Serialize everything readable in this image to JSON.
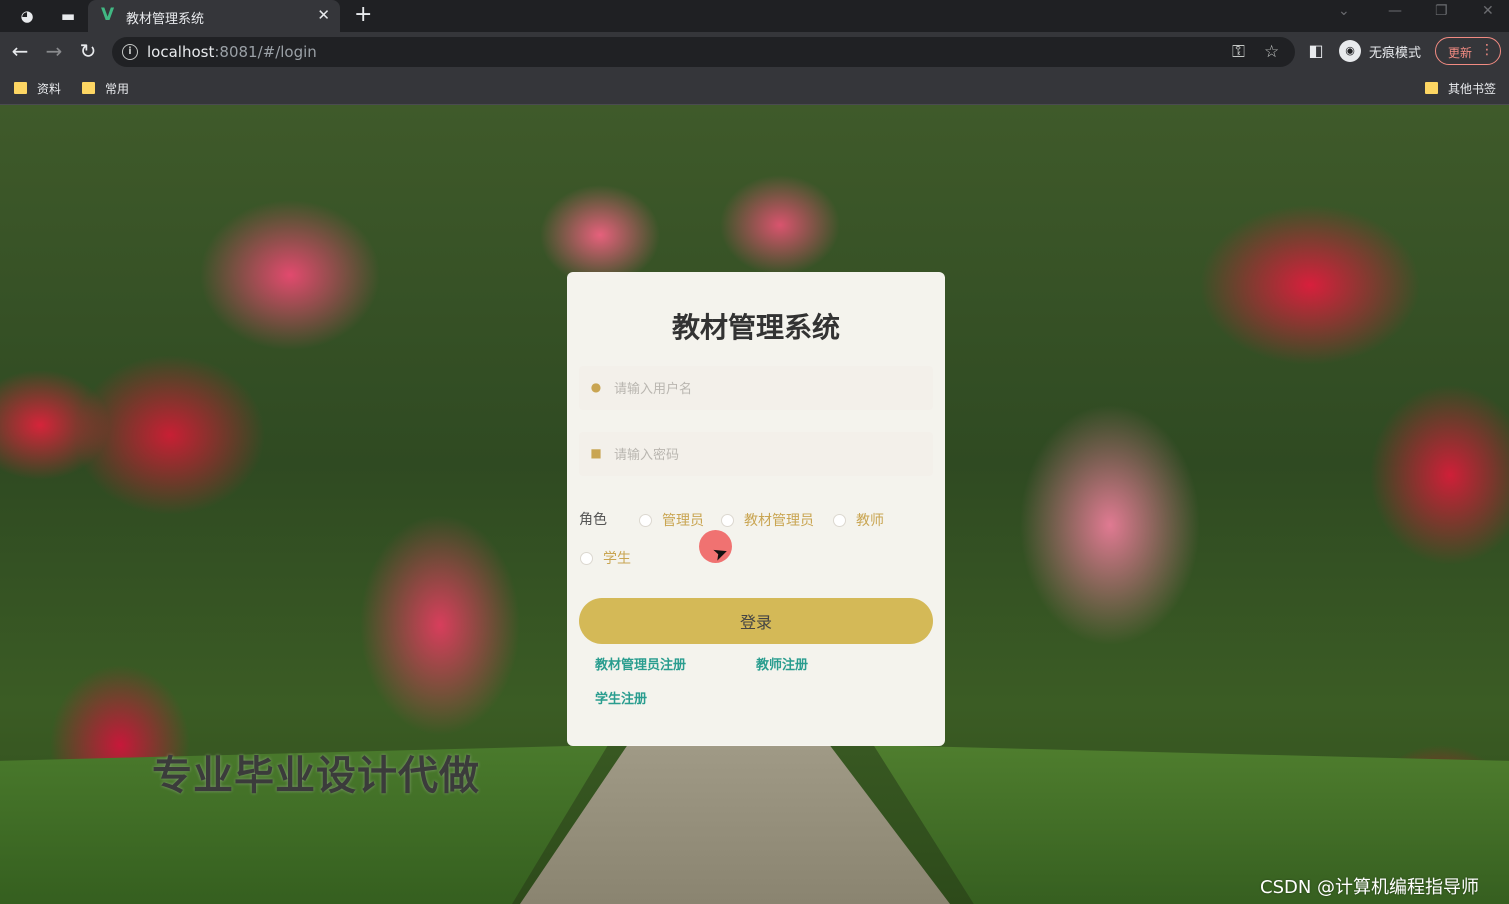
{
  "browser": {
    "tab_title": "教材管理系统",
    "url_host": "localhost",
    "url_rest": ":8081/#/login",
    "profile_label": "无痕模式",
    "update_label": "更新",
    "bookmarks": [
      "资料",
      "常用"
    ],
    "other_bookmarks": "其他书签"
  },
  "login": {
    "title": "教材管理系统",
    "username_placeholder": "请输入用户名",
    "password_placeholder": "请输入密码",
    "role_label": "角色",
    "roles": [
      "管理员",
      "教材管理员",
      "教师",
      "学生"
    ],
    "login_button": "登录",
    "register_links": [
      "教材管理员注册",
      "教师注册",
      "学生注册"
    ]
  },
  "overlay": {
    "watermark": "专业毕业设计代做",
    "credit": "CSDN @计算机编程指导师"
  },
  "colors": {
    "accent": "#d4b957",
    "link": "#2a9d8f",
    "role_text": "#c9a552"
  }
}
